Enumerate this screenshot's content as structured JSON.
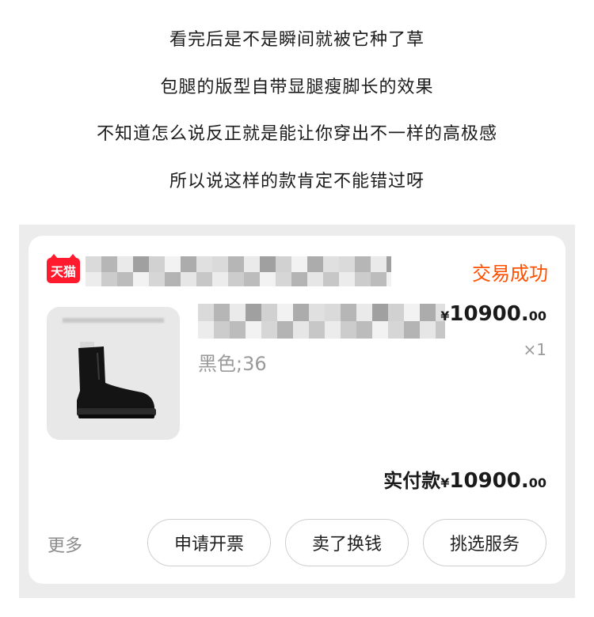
{
  "captions": [
    "看完后是不是瞬间就被它种了草",
    "包腿的版型自带显腿瘦脚长的效果",
    "不知道怎么说反正就是能让你穿出不一样的高极感",
    "所以说这样的款肯定不能错过呀"
  ],
  "order": {
    "store_badge": "天猫",
    "store_badge_color": "#ff1a2e",
    "status": "交易成功",
    "status_color": "#ff5000",
    "product": {
      "variant": "黑色;36",
      "price_symbol": "¥",
      "price_int": "10900.",
      "price_dec": "00",
      "quantity": "×1"
    },
    "total": {
      "label": "实付款",
      "symbol": "¥",
      "int": "10900.",
      "dec": "00"
    },
    "more_label": "更多",
    "actions": [
      "申请开票",
      "卖了换钱",
      "挑选服务"
    ]
  }
}
